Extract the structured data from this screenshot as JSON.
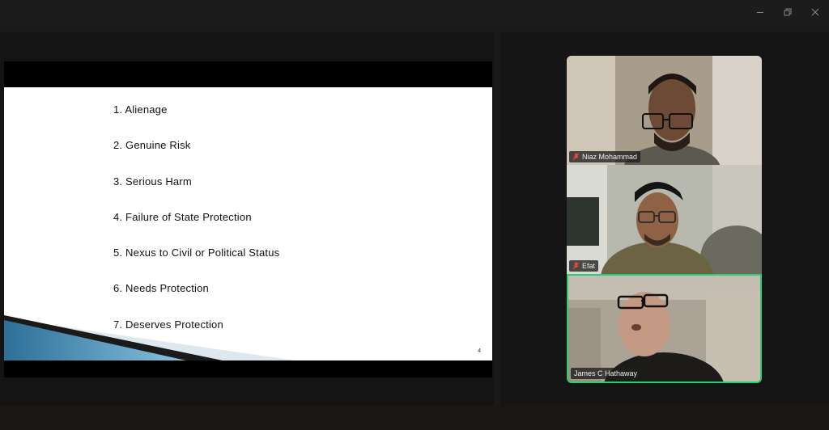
{
  "window": {
    "controls": [
      "minimize-icon",
      "restore-icon",
      "close-icon"
    ]
  },
  "slide": {
    "items": [
      "1. Alienage",
      "2. Genuine Risk",
      "3. Serious Harm",
      "4. Failure of State Protection",
      "5. Nexus to Civil or Political Status",
      "6. Needs Protection",
      "7. Deserves Protection"
    ],
    "page_number": "4"
  },
  "participants": [
    {
      "name": "Niaz Mohammad",
      "muted": true,
      "speaking": false
    },
    {
      "name": "Efat",
      "muted": true,
      "speaking": false
    },
    {
      "name": "James C Hathaway",
      "muted": false,
      "speaking": true
    }
  ],
  "colors": {
    "active_speaker_border": "#2ecc71",
    "muted_icon": "#e74c3c"
  }
}
